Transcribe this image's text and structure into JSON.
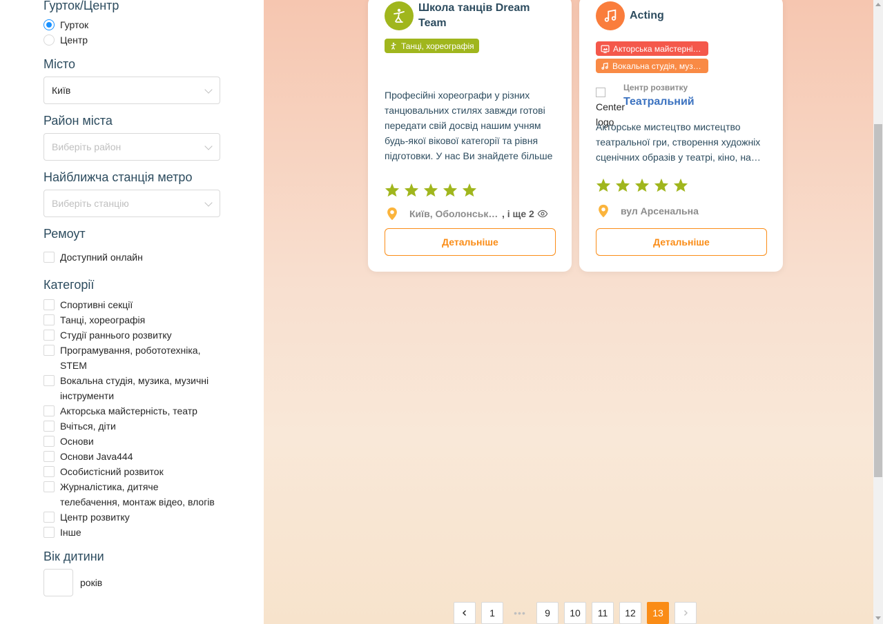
{
  "sidebar": {
    "type_section": {
      "title": "Гурток/Центр",
      "options": [
        {
          "label": "Гурток",
          "checked": true
        },
        {
          "label": "Центр",
          "checked": false
        }
      ]
    },
    "city": {
      "title": "Місто",
      "value": "Київ"
    },
    "district": {
      "title": "Район міста",
      "placeholder": "Виберіть район"
    },
    "metro": {
      "title": "Найближча станція метро",
      "placeholder": "Виберіть станцію"
    },
    "remote": {
      "title": "Ремоут",
      "option": "Доступний онлайн"
    },
    "categories": {
      "title": "Категорії",
      "items": [
        "Спортивні секції",
        "Танці, хореографія",
        "Студії раннього розвитку",
        "Програмування, робототехніка, STEM",
        "Вокальна студія, музика, музичні інструменти",
        "Акторська майстерність, театр",
        "Вчіться, діти",
        "Основи",
        "Основи Java444",
        "Особистісний розвиток",
        "Журналістика, дитяче телебачення, монтаж відео, влогів",
        "Центр розвитку",
        "Інше"
      ]
    },
    "age": {
      "title": "Вік дитини",
      "unit": "років"
    }
  },
  "cards": [
    {
      "title": "Школа танців Dream Team",
      "icon": "dance-icon",
      "icon_color": "#a0b61d",
      "tags": [
        {
          "label": "Танці, хореографія",
          "color": "#a0b61d"
        }
      ],
      "description": "Професійні хореографи у різних танцювальних стилях завжди готові передати свій досвід нашим учням будь-якої вікової категорії та рівня підготовки. У нас Ви знайдете більше",
      "rating": 5,
      "location": "Київ, Оболонський",
      "location_more": ", і ще 2",
      "button": "Детальніше"
    },
    {
      "title": "Acting",
      "icon": "music-note-icon",
      "icon_color": "#fa7d3c",
      "tags": [
        {
          "label": "Акторська майстерність, театр",
          "color": "#f4584b"
        },
        {
          "label": "Вокальна студія, музика",
          "color": "#f98a45"
        }
      ],
      "center_logo_alt": "Center logo",
      "center_label": "Центр розвитку",
      "center_name": "Театральний",
      "description": "Акторське мистецтво мистецтво театральної гри, створення художніх сценічних образів у театрі, кіно, на телебаченні",
      "rating": 5,
      "location": "вул Арсенальна",
      "button": "Детальніше"
    }
  ],
  "pagination": {
    "pages": [
      "1",
      "•••",
      "9",
      "10",
      "11",
      "12",
      "13"
    ],
    "current": "13"
  },
  "colors": {
    "accent": "#fa8c16",
    "star": "#a0b61d",
    "title": "#2d4c5f"
  }
}
